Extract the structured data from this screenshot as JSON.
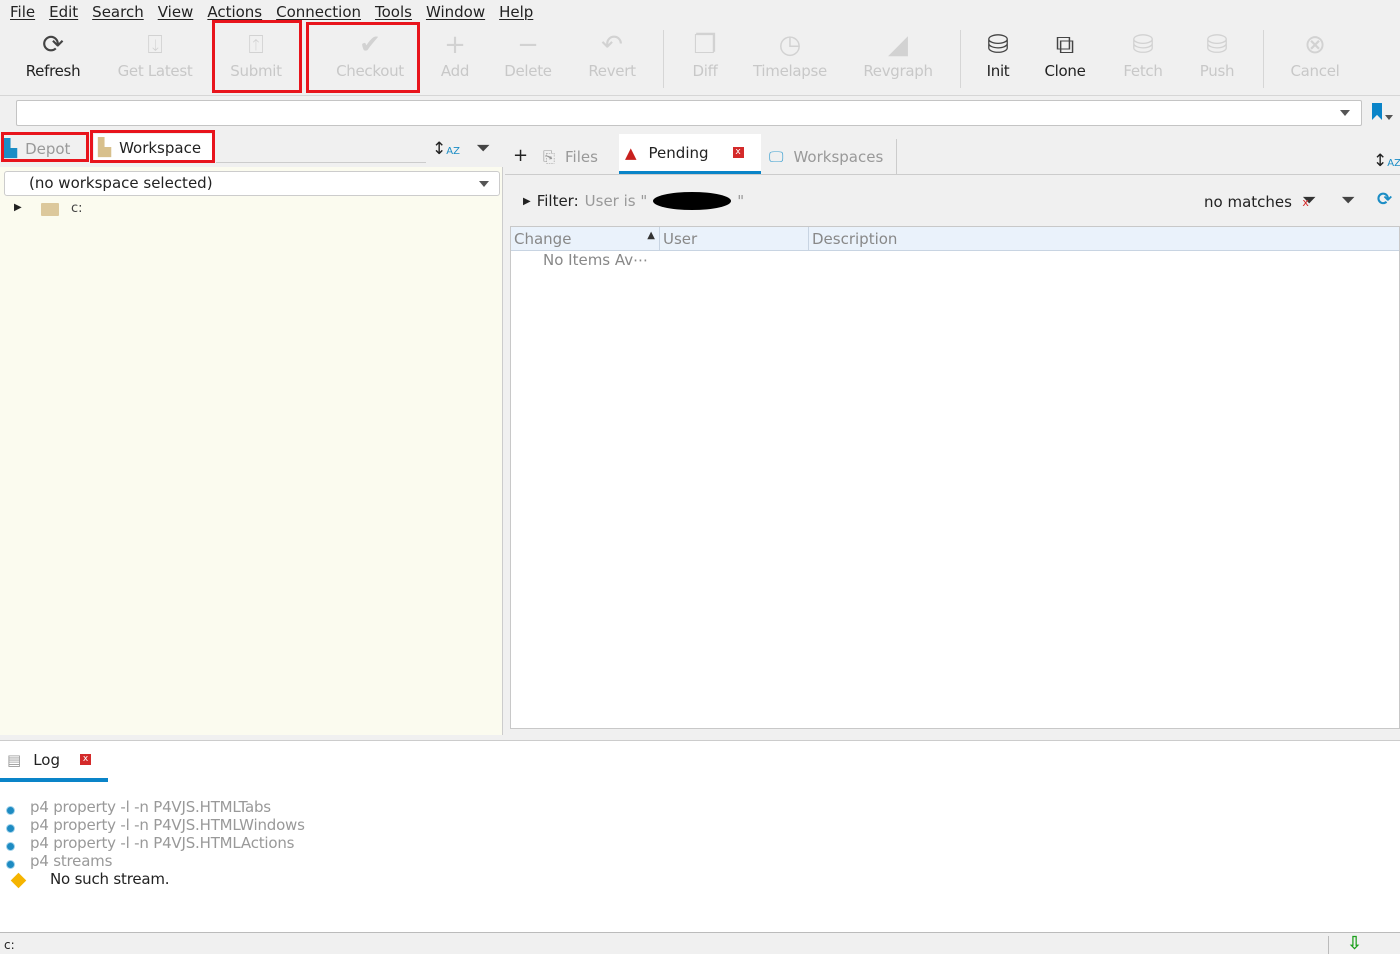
{
  "menu": [
    "File",
    "Edit",
    "Search",
    "View",
    "Actions",
    "Connection",
    "Tools",
    "Window",
    "Help"
  ],
  "toolbar": {
    "refresh": "Refresh",
    "get_latest": "Get Latest",
    "submit": "Submit",
    "checkout": "Checkout",
    "add": "Add",
    "delete": "Delete",
    "revert": "Revert",
    "diff": "Diff",
    "timelapse": "Timelapse",
    "revgraph": "Revgraph",
    "init": "Init",
    "clone": "Clone",
    "fetch": "Fetch",
    "push": "Push",
    "cancel": "Cancel"
  },
  "address": {
    "value": ""
  },
  "left": {
    "tabs": {
      "depot": "Depot",
      "workspace": "Workspace"
    },
    "workspace_select": "(no workspace selected)",
    "tree": [
      {
        "label": "c:"
      }
    ]
  },
  "right": {
    "tabs": {
      "files": "Files",
      "pending": "Pending",
      "workspaces": "Workspaces"
    },
    "filter": {
      "label": "Filter:",
      "text": "User is \"",
      "close_quote": "\"",
      "matches": "no matches"
    },
    "columns": [
      "Change",
      "User",
      "Description"
    ],
    "empty": "No Items Av⋯"
  },
  "log": {
    "tab": "Log",
    "lines": [
      "p4 property -l -n P4VJS.HTMLTabs",
      "p4 property -l -n P4VJS.HTMLWindows",
      "p4 property -l -n P4VJS.HTMLActions",
      "p4 streams"
    ],
    "warning": "No such stream."
  },
  "status": {
    "path": "c:"
  },
  "colors": {
    "accent": "#0a84c8",
    "highlight": "#e8141c"
  }
}
